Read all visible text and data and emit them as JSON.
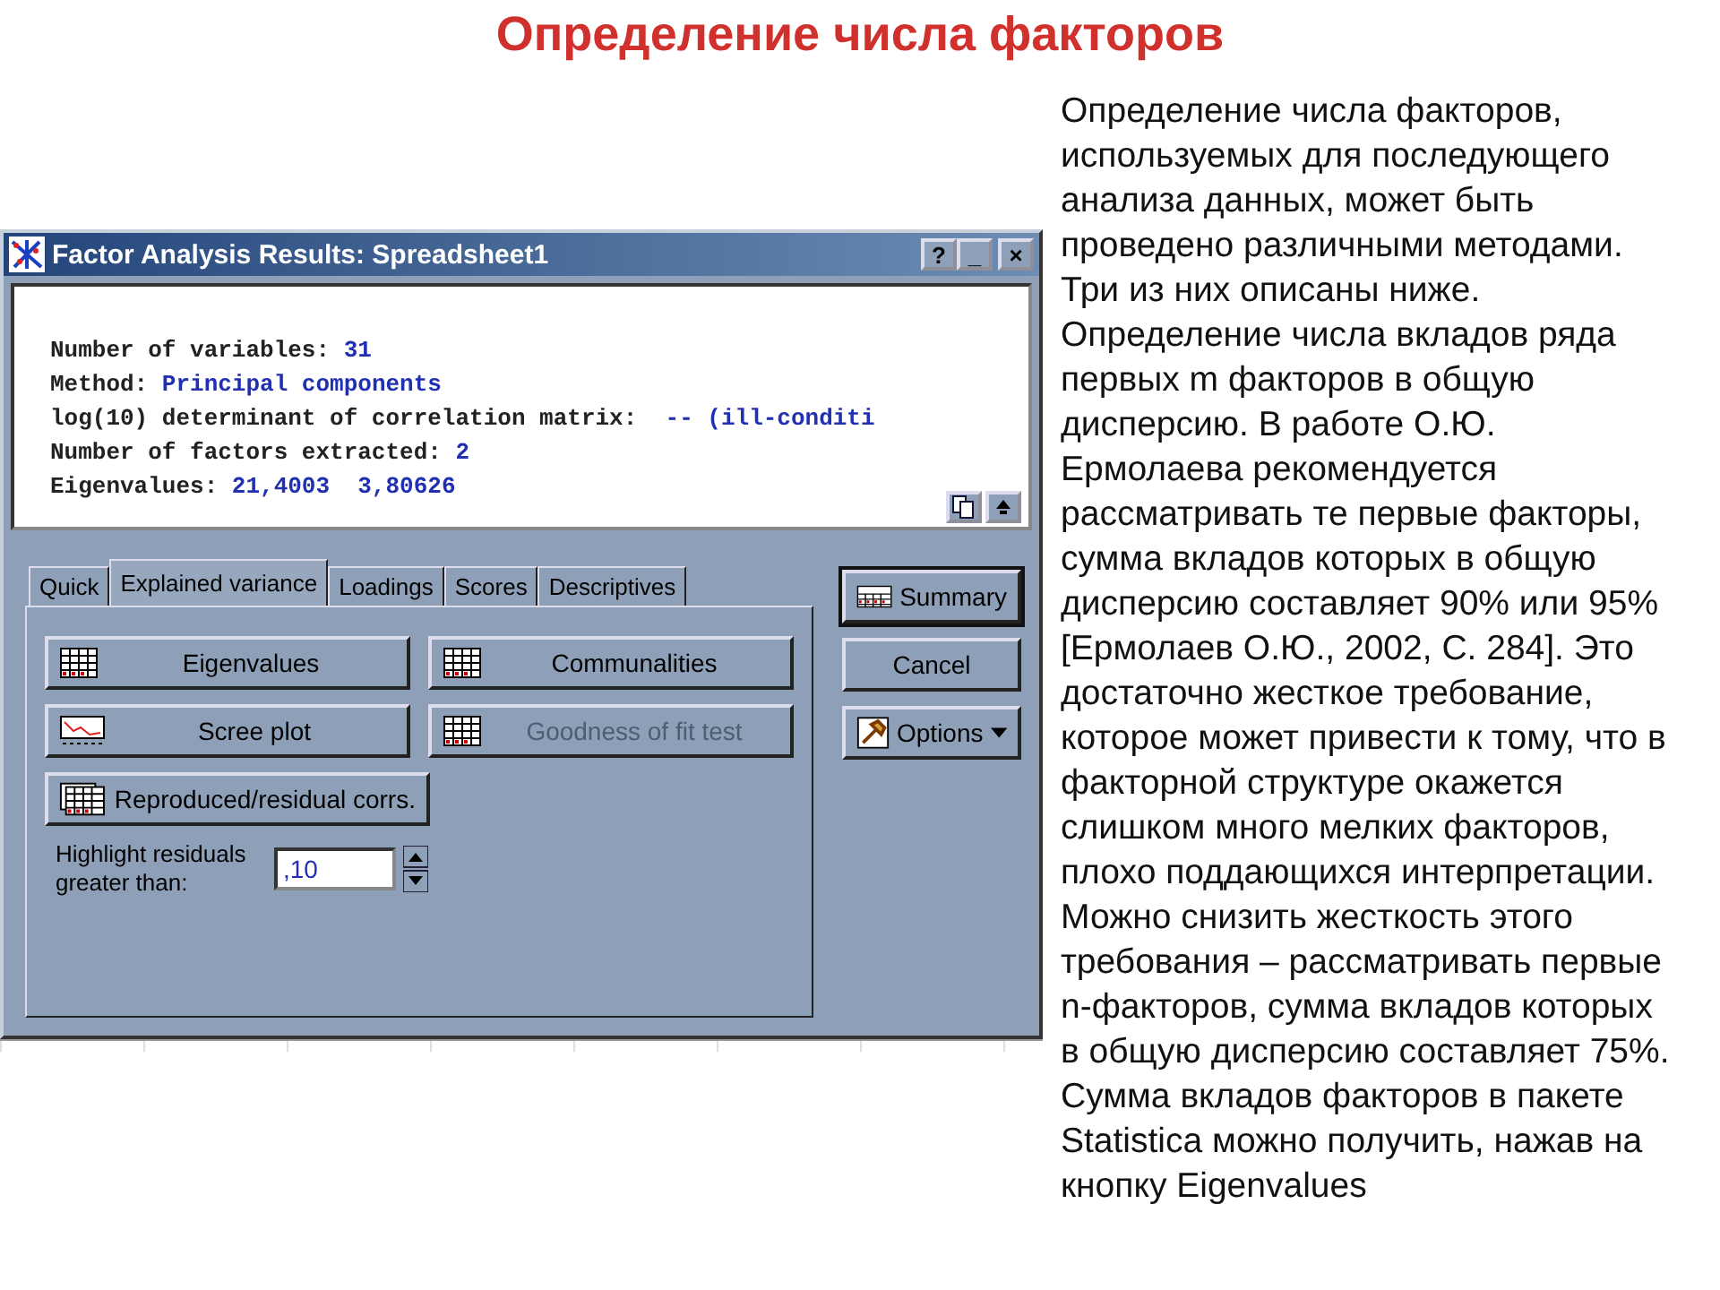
{
  "slide_title": "Определение числа факторов",
  "window": {
    "title": "Factor Analysis Results: Spreadsheet1",
    "title_buttons": [
      "?",
      "_",
      "×"
    ],
    "output_lines": [
      {
        "label": "Number of variables: ",
        "value": "31"
      },
      {
        "label": "Method: ",
        "value": "Principal components"
      },
      {
        "label": "log(10) determinant of correlation matrix:  ",
        "value": "-- (ill-conditi"
      },
      {
        "label": "Number of factors extracted: ",
        "value": "2"
      },
      {
        "label": "Eigenvalues: ",
        "value": "21,4003  3,80626"
      }
    ],
    "tabs": [
      {
        "label": "Quick",
        "selected": false
      },
      {
        "label": "Explained variance",
        "selected": true
      },
      {
        "label": "Loadings",
        "selected": false
      },
      {
        "label": "Scores",
        "selected": false
      },
      {
        "label": "Descriptives",
        "selected": false
      }
    ],
    "buttons": [
      {
        "label": "Eigenvalues",
        "kind": "grid",
        "disabled": false
      },
      {
        "label": "Communalities",
        "kind": "grid",
        "disabled": false
      },
      {
        "label": "Scree plot",
        "kind": "plot",
        "disabled": false
      },
      {
        "label": "Goodness of fit test",
        "kind": "grid",
        "disabled": true
      },
      {
        "label": "Reproduced/residual corrs.",
        "kind": "multigrid",
        "disabled": false
      }
    ],
    "highlight": {
      "label": "Highlight residuals greater than:",
      "value": ",10"
    },
    "side_buttons": [
      {
        "label": "Summary",
        "kind": "summary"
      },
      {
        "label": "Cancel",
        "kind": "plain"
      },
      {
        "label": "Options",
        "kind": "options"
      }
    ]
  },
  "paragraph": "Определение числа факторов, используемых для последующего анализа данных, может быть проведено различными методами. Три из них описаны ниже. Определение числа вкладов ряда первых m факторов в общую дисперсию. В работе О.Ю. Ермолаева рекомендуется рассматривать те первые факторы, сумма вкладов которых в общую дисперсию составляет 90% или 95% [Ермолаев О.Ю., 2002, С. 284]. Это достаточно жесткое требование, которое может привести к тому, что в факторной структуре окажется слишком много мелких факторов, плохо поддающихся интерпретации. Можно снизить жесткость этого требования – рассматривать первые n-факторов, сумма вкладов которых в общую дисперсию составляет 75%. Сумма вкладов факторов в пакете Statistica можно получить, нажав на кнопку Eigenvalues"
}
